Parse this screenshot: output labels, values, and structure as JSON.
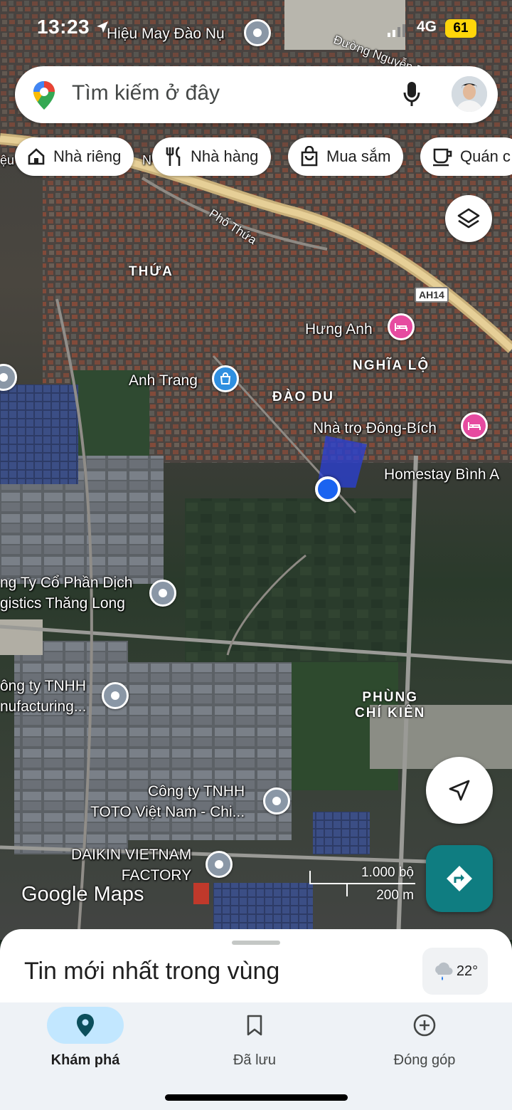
{
  "status_bar": {
    "time": "13:23",
    "network": "4G",
    "battery": "61",
    "battery_color": "#ffd60a"
  },
  "search": {
    "placeholder": "Tìm kiếm ở đây",
    "icons": [
      "maps-pin-icon",
      "microphone-icon",
      "avatar"
    ]
  },
  "chips": [
    {
      "label": "Nhà riêng",
      "icon": "home-icon"
    },
    {
      "label": "Nhà hàng",
      "icon": "restaurant-icon"
    },
    {
      "label": "Mua sắm",
      "icon": "shopping-bag-icon"
    },
    {
      "label": "Quán c",
      "icon": "coffee-icon"
    }
  ],
  "map": {
    "streets": {
      "top_road": "Đường Nguyễn Bỉn",
      "pho_thua": "Phố Thứa",
      "highway_shield": "AH14"
    },
    "areas": {
      "thua": "THỨA",
      "nghia_lo": "NGHĨA LỘ",
      "dao_du": "ĐÀO DU",
      "phung_chi_kien_1": "PHÙNG",
      "phung_chi_kien_2": "CHÍ KIÊN"
    },
    "places": {
      "hieu_may": "Hiệu May Đào Nụ",
      "hung_anh": "Hưng Anh",
      "anh_trang": "Anh Trang",
      "nha_tro": "Nhà trọ Đông-Bích",
      "homestay": "Homestay Bình A",
      "logistics_1": "ng Ty Cổ Phần Dịch",
      "logistics_2": "gistics Thăng Long",
      "tnhh_1": "ông ty TNHH",
      "tnhh_2": "nufacturing...",
      "toto_1": "Công ty TNHH",
      "toto_2": "TOTO Việt Nam - Chi...",
      "daikin_1": "DAIKIN VIETNAM",
      "daikin_2": "FACTORY",
      "cut_label": "ệu",
      "cut_label2": "N"
    },
    "scale": {
      "feet": "1.000 bộ",
      "meters": "200 m"
    },
    "logo": "Google Maps",
    "brand_colors": {
      "directions": "#0f7d81",
      "pink_poi": "#e64ba0",
      "location": "#1a63f0"
    }
  },
  "sheet": {
    "title": "Tin mới nhất trong vùng",
    "weather": "22°"
  },
  "nav": {
    "items": [
      {
        "label": "Khám phá",
        "icon": "explore-pin-icon",
        "active": true
      },
      {
        "label": "Đã lưu",
        "icon": "bookmark-icon",
        "active": false
      },
      {
        "label": "Đóng góp",
        "icon": "add-circle-icon",
        "active": false
      }
    ],
    "active_color": "#c2e7ff"
  }
}
